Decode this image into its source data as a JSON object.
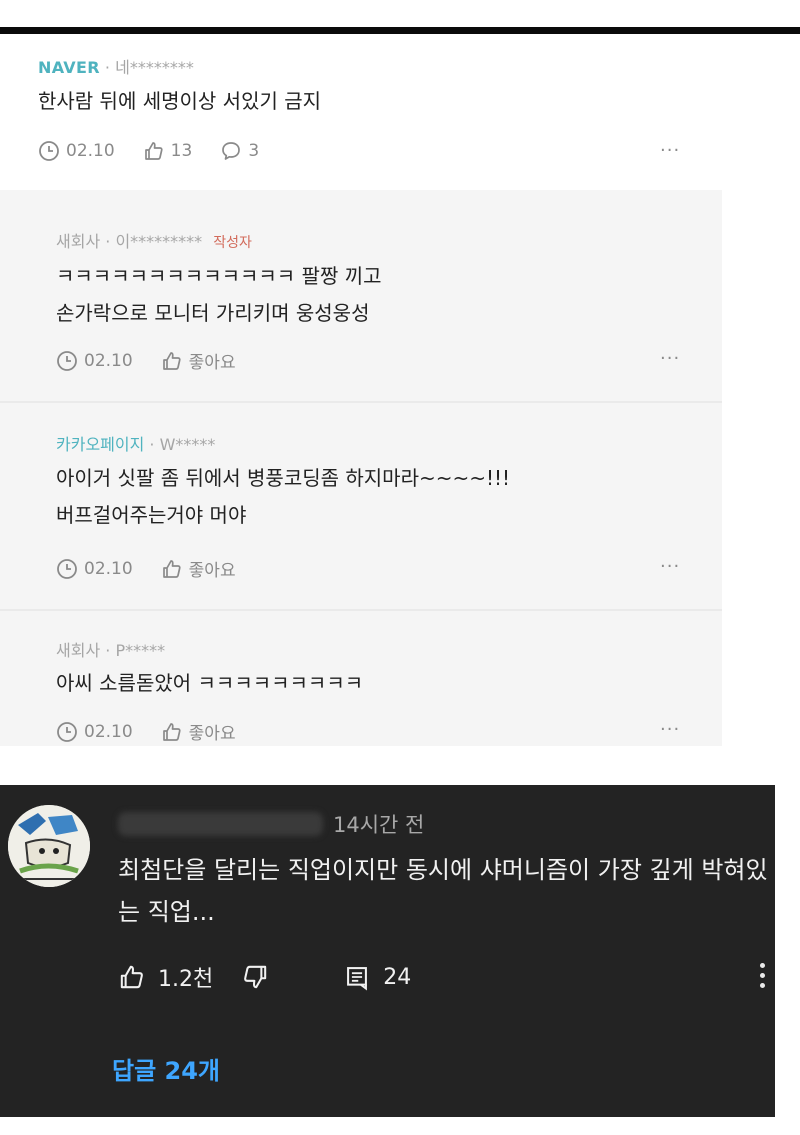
{
  "naver": {
    "main_comment": {
      "source": "NAVER",
      "user": "네********",
      "text": "한사람 뒤에 세명이상 서있기 금지",
      "date": "02.10",
      "likes": "13",
      "replies_count": "3",
      "more": "···"
    },
    "replies": [
      {
        "source": "새회사",
        "user": "이*********",
        "tag": "작성자",
        "line1": "ㅋㅋㅋㅋㅋㅋㅋㅋㅋㅋㅋㅋㅋ 팔짱 끼고",
        "line2": "손가락으로 모니터 가리키며 웅성웅성",
        "date": "02.10",
        "like_label": "좋아요",
        "more": "···"
      },
      {
        "source": "카카오페이지",
        "user": "W*****",
        "line1": "아이거 싯팔 좀 뒤에서 병풍코딩좀 하지마라~~~~!!!",
        "line2": "버프걸어주는거야 머야",
        "date": "02.10",
        "like_label": "좋아요",
        "more": "···"
      },
      {
        "source": "새회사",
        "user": "P*****",
        "line1": "아씨 소름돋았어 ㅋㅋㅋㅋㅋㅋㅋㅋㅋ",
        "date": "02.10",
        "like_label": "좋아요",
        "more": "···"
      }
    ]
  },
  "youtube": {
    "time": "14시간 전",
    "text": "최첨단을 달리는 직업이지만 동시에 샤머니즘이 가장 깊게 박혀있는 직업...",
    "likes": "1.2천",
    "reply_count": "24",
    "replies_link": "답글 24개"
  },
  "icons": {
    "clock": "clock-icon",
    "thumb_up": "thumbs-up-icon",
    "comment": "speech-bubble-icon",
    "thumb_down": "thumbs-down-icon",
    "reply": "reply-comment-icon",
    "more": "kebab-menu-icon"
  },
  "colors": {
    "naver_source": "#4fb3bf",
    "author_tag": "#d26b5b",
    "youtube_bg": "#232323",
    "youtube_link": "#3ea6ff"
  }
}
